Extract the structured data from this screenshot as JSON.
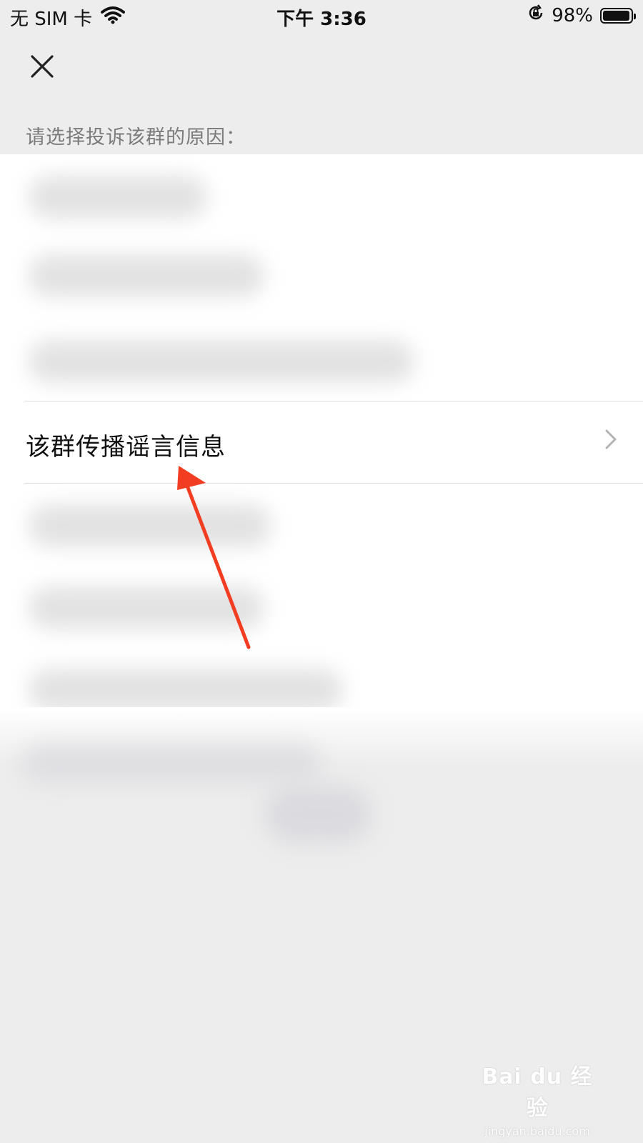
{
  "status_bar": {
    "carrier": "无 SIM 卡",
    "time": "下午 3:36",
    "battery": "98%",
    "battery_level": 0.98
  },
  "nav": {
    "close_icon": "close-icon"
  },
  "page": {
    "hint": "请选择投诉该群的原因："
  },
  "reasons": {
    "highlighted": "该群传播谣言信息"
  },
  "watermark": {
    "logo": "Bai du 经验",
    "url": "jingyan.baidu.com"
  },
  "colors": {
    "annotation_arrow": "#f23d22",
    "background": "#ededed",
    "list_bg": "#ffffff"
  }
}
